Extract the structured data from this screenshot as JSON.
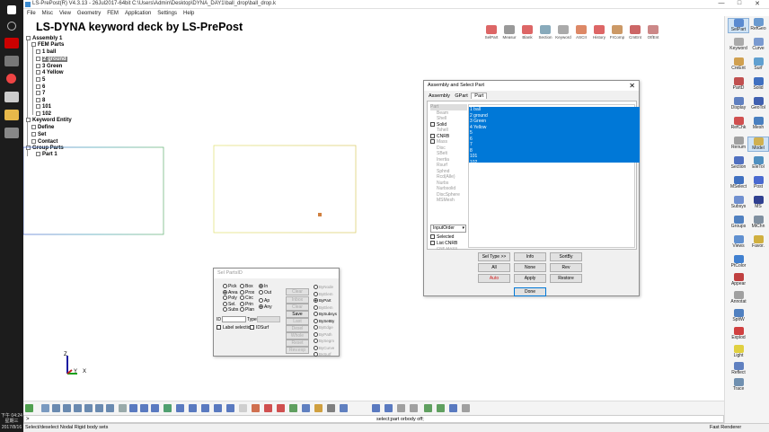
{
  "window": {
    "title": "LS-PrePost(R) V4.3.13 - 26Jul2017-64bit C:\\Users\\Admin\\Desktop\\DYNA_DAY1\\ball_drop\\ball_drop.k",
    "controls": [
      "—",
      "□",
      "✕"
    ]
  },
  "menubar": [
    "File",
    "Misc",
    "View",
    "Geometry",
    "FEM",
    "Application",
    "Settings",
    "Help"
  ],
  "deck_title": "LS-DYNA keyword deck by LS-PrePost",
  "tree": {
    "assembly": "Assembly 1",
    "fem_parts": "FEM Parts",
    "parts": [
      "1 ball",
      "2 ground",
      "3 Green",
      "4 Yellow",
      "5",
      "6",
      "7",
      "8",
      "101",
      "102"
    ],
    "others": [
      "Keyword Entity",
      "Define",
      "Set",
      "Contact",
      "Group Parts",
      "Part 1"
    ]
  },
  "top_toolbar": [
    "SelPart",
    "Measur",
    "Blank",
    "Section",
    "Keyword",
    "ASCII",
    "History",
    "FrComp",
    "CmEnt",
    "OtfEnt"
  ],
  "right_panel": [
    "SelPart",
    "RefGeo",
    "Keyword",
    "Curve",
    "CreEnt",
    "Surf",
    "PartD",
    "Solid",
    "Display",
    "GeoTol",
    "RefChk",
    "Mesh",
    "Renum",
    "Model",
    "Section",
    "EleTol",
    "MSelect",
    "Post",
    "Subsys",
    "MS",
    "Groups",
    "MtChn",
    "Views",
    "Favor.",
    "PtColor",
    "Appear",
    "Annotat",
    "SpltW",
    "Explod",
    "Light",
    "Reflect",
    "Trace"
  ],
  "assembly_dialog": {
    "title": "Assembly and Select Part",
    "tabs": [
      "Assembly",
      "GPart",
      "Part"
    ],
    "entity_types": [
      "Part",
      "Beam",
      "Shell",
      "Solid",
      "Tshell",
      "CNRB",
      "Mass",
      "Disc",
      "SBelt",
      "Inertia",
      "Rsurf",
      "Sphnd",
      "Rcd(Alle)",
      "Nurbs",
      "Nurbsolid",
      "DiscSphere",
      "MSMesh"
    ],
    "input_order": "InputOrder",
    "selected_label": "Selected",
    "list_label": "List CNRB",
    "footer_note": "CNF MASS",
    "part_list": [
      "1 ball",
      "2 ground",
      "3 Green",
      "4 Yellow",
      "5",
      "6",
      "7",
      "8",
      "101",
      "102"
    ],
    "buttons": [
      "Sel Type >>",
      "Info",
      "SortBy",
      "All",
      "None",
      "Rev",
      "Auto",
      "Apply",
      "Restore"
    ],
    "done": "Done"
  },
  "sel_dialog": {
    "title": "Sel PartsID",
    "col1": [
      "Pick",
      "Area",
      "Poly",
      "Sel.",
      "Subs"
    ],
    "col2": [
      "Box",
      "Prox",
      "Circ",
      "Prin",
      "Plan"
    ],
    "col3": [
      "In",
      "Out",
      "Ap",
      "Any"
    ],
    "buttons": [
      "Clear",
      "Inbox",
      "Clear",
      "Save",
      "Last",
      "Desel",
      "Whole",
      "Reset",
      "Rev.exp"
    ],
    "right_options": [
      "ByNode",
      "ByElem",
      "ByPart",
      "ByElem",
      "BySubsys",
      "BySetBy",
      "ByEdge",
      "ByPath",
      "BySegm",
      "ByCurve",
      "BySurf"
    ],
    "id_label": "ID",
    "type_label": "Type",
    "label_selection": "Label selection",
    "id_surf": "IDSurf"
  },
  "command_line": ">",
  "command_echo": "select;part orbody off;",
  "status_left": "Select/deselect Nodal Rigid body sets",
  "status_right": "Fast Renderer",
  "axis": {
    "x": "X",
    "y": "Y",
    "z": "Z"
  },
  "clock": [
    "下午 04:24",
    "星期三",
    "2017/8/16"
  ],
  "colors": {
    "selection": "#0078d7",
    "mesh_blue": "#3c78c8",
    "mesh_yellow": "#d8d870"
  }
}
